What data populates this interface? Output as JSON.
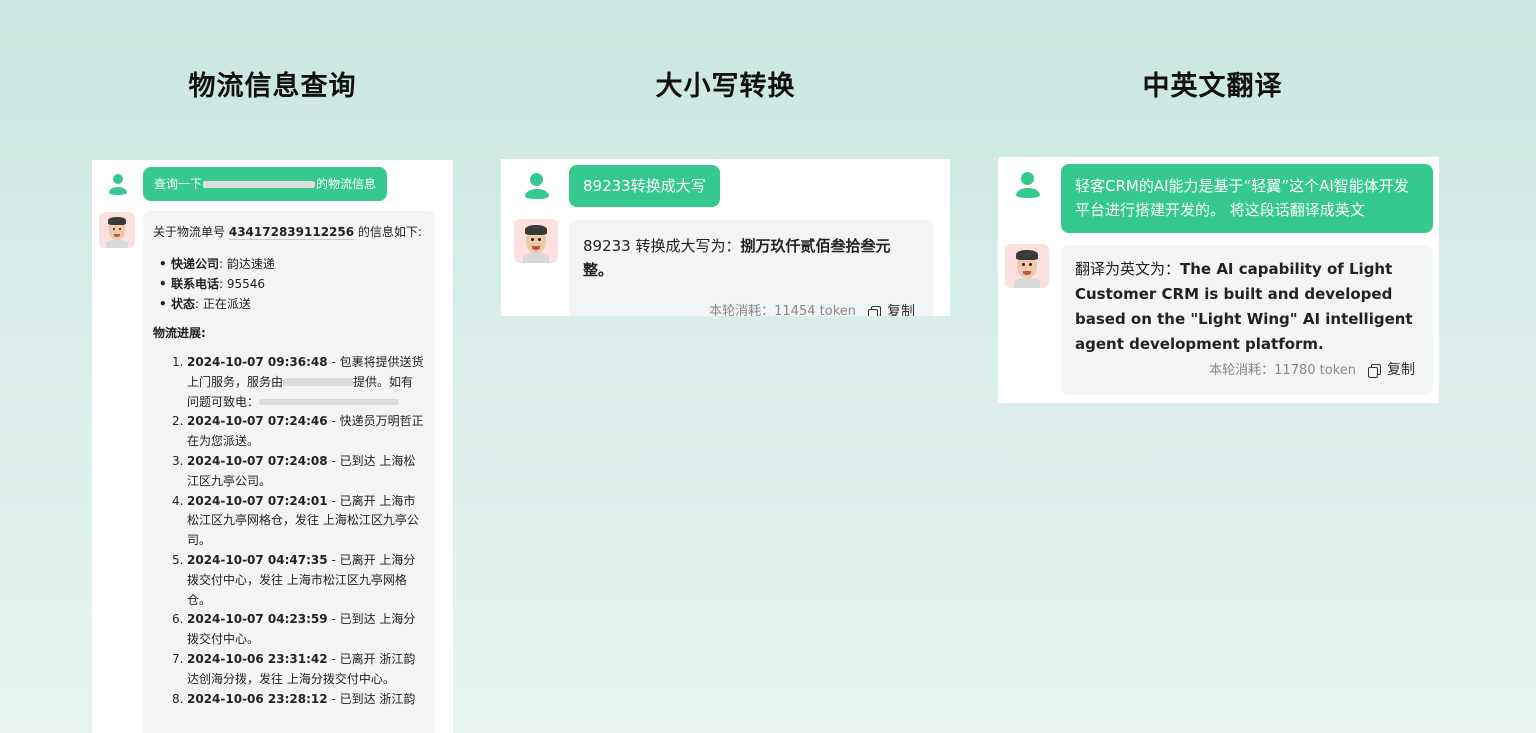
{
  "headings": {
    "left": "物流信息查询",
    "middle": "大小写转换",
    "right": "中英文翻译"
  },
  "logistics": {
    "user_prefix": "查询一下",
    "user_suffix": "的物流信息",
    "intro_prefix": "关于物流单号",
    "tracking_number": "434172839112256",
    "intro_suffix": "的信息如下:",
    "info": [
      {
        "label": "快递公司",
        "value": "韵达速递"
      },
      {
        "label": "联系电话",
        "value": "95546"
      },
      {
        "label": "状态",
        "value": "正在派送"
      }
    ],
    "progress_title": "物流进展",
    "progress": [
      {
        "idx": "1.",
        "time": "2024-10-07 09:36:48",
        "text": " - 包裹将提供送货上门服务，服务由",
        "text2": "提供。如有问题可致电："
      },
      {
        "idx": "2.",
        "time": "2024-10-07 07:24:46",
        "text": " - 快递员万明哲正在为您派送。"
      },
      {
        "idx": "3.",
        "time": "2024-10-07 07:24:08",
        "text": " - 已到达 上海松江区九亭公司。"
      },
      {
        "idx": "4.",
        "time": "2024-10-07 07:24:01",
        "text": " - 已离开 上海市松江区九亭网格仓，发往 上海松江区九亭公司。"
      },
      {
        "idx": "5.",
        "time": "2024-10-07 04:47:35",
        "text": " - 已离开 上海分拨交付中心，发往 上海市松江区九亭网格仓。"
      },
      {
        "idx": "6.",
        "time": "2024-10-07 04:23:59",
        "text": " - 已到达 上海分拨交付中心。"
      },
      {
        "idx": "7.",
        "time": "2024-10-06 23:31:42",
        "text": " - 已离开 浙江韵达创海分拨，发往 上海分拨交付中心。"
      },
      {
        "idx": "8.",
        "time": "2024-10-06 23:28:12",
        "text": " - 已到达 浙江韵"
      }
    ]
  },
  "case_convert": {
    "user_message": "89233转换成大写",
    "reply_prefix": "89233 转换成大写为：",
    "reply_bold": "捌万玖仟贰佰叁拾叁元整。",
    "usage": "本轮消耗：11454 token",
    "copy_label": "复制"
  },
  "translate": {
    "user_message": "轻客CRM的AI能力是基于“轻翼”这个AI智能体开发平台进行搭建开发的。 将这段话翻译成英文",
    "reply_prefix": "翻译为英文为：",
    "reply_bold": "The AI capability of Light Customer CRM is built and developed based on the \"Light Wing\" AI intelligent agent development platform.",
    "usage": "本轮消耗：11780 token",
    "copy_label": "复制"
  },
  "colors": {
    "accent": "#35c98e",
    "bubble_gray": "#f3f4f6",
    "avatar_bg": "#fde0e0"
  }
}
